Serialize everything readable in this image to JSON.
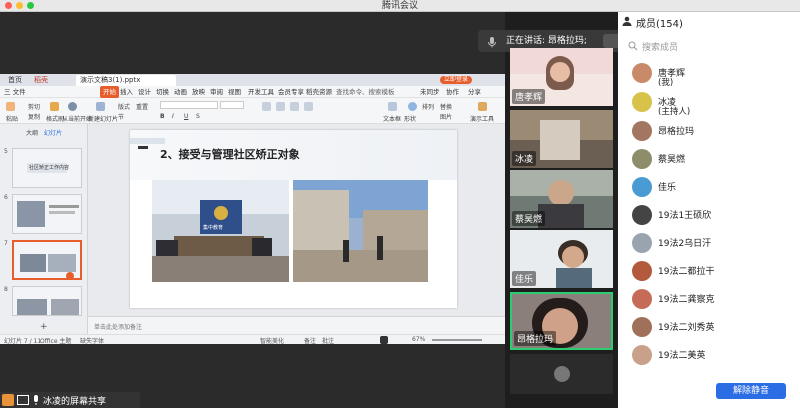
{
  "window": {
    "title": "腾讯会议"
  },
  "speaking": {
    "label": "正在讲话: 昂格拉玛;"
  },
  "wps": {
    "tabs": [
      "首页",
      "稻壳",
      "演示文稿3(1).pptx"
    ],
    "login": "立即登录",
    "ribbon_tabs": [
      "三 文件",
      "开始",
      "插入",
      "设计",
      "切换",
      "动画",
      "放映",
      "审阅",
      "视图",
      "开发工具",
      "会员专享",
      "稻壳资源"
    ],
    "search": "查找命令、搜索模板",
    "right_tabs": [
      "未同步",
      "协作",
      "分享"
    ],
    "ribbon": {
      "cut": "剪切",
      "copy": "复制",
      "paste": "粘贴",
      "format_painter": "格式刷",
      "play": "从当前开始",
      "new_slide": "新建幻灯片",
      "layout": "版式",
      "section": "节",
      "reset": "重置",
      "textbox": "文本框",
      "shape": "形状",
      "arrange": "排列",
      "replace": "替换",
      "picture": "图片",
      "tools": "演示工具"
    },
    "panel_tabs": [
      "大纲",
      "幻灯片"
    ],
    "thumbs": [
      "5",
      "6",
      "7",
      "8"
    ],
    "thumb_title": "社区矫正工作内容",
    "slide": {
      "heading": "2、接受与管理社区矫正对象",
      "sign": "集中教育"
    },
    "notes": "单击此处添加备注",
    "status": {
      "page": "幻灯片 7 / 11",
      "theme": "Office 主题",
      "repair": "缺失字体",
      "beautify": "智能美化",
      "notes": "备注",
      "comment": "批注",
      "zoom": "67%"
    }
  },
  "videos": [
    {
      "name": "唐孝辉"
    },
    {
      "name": "冰凌"
    },
    {
      "name": "蔡昊燃"
    },
    {
      "name": "佳乐"
    },
    {
      "name": "昂格拉玛"
    }
  ],
  "bottom": {
    "label": "冰凌的屏幕共享"
  },
  "members": {
    "title": "成员(154)",
    "search": "搜索成员",
    "list": [
      {
        "name": "唐孝辉",
        "sub": "(我)",
        "color": "#c98a6a"
      },
      {
        "name": "冰凌",
        "sub": "(主持人)",
        "color": "#d8c24a"
      },
      {
        "name": "昂格拉玛",
        "sub": "",
        "color": "#a27660"
      },
      {
        "name": "蔡昊燃",
        "sub": "",
        "color": "#8d8d6a"
      },
      {
        "name": "佳乐",
        "sub": "",
        "color": "#4a9bd4"
      },
      {
        "name": "19法1王硕欣",
        "sub": "",
        "color": "#444"
      },
      {
        "name": "19法2乌日汗",
        "sub": "",
        "color": "#9aa4b0"
      },
      {
        "name": "19法二都拉干",
        "sub": "",
        "color": "#b35a3c"
      },
      {
        "name": "19法二龚察克",
        "sub": "",
        "color": "#c56b57"
      },
      {
        "name": "19法二刘秀英",
        "sub": "",
        "color": "#a0705a"
      },
      {
        "name": "19法二美英",
        "sub": "",
        "color": "#c9a08a"
      }
    ],
    "unmute": "解除静音"
  }
}
